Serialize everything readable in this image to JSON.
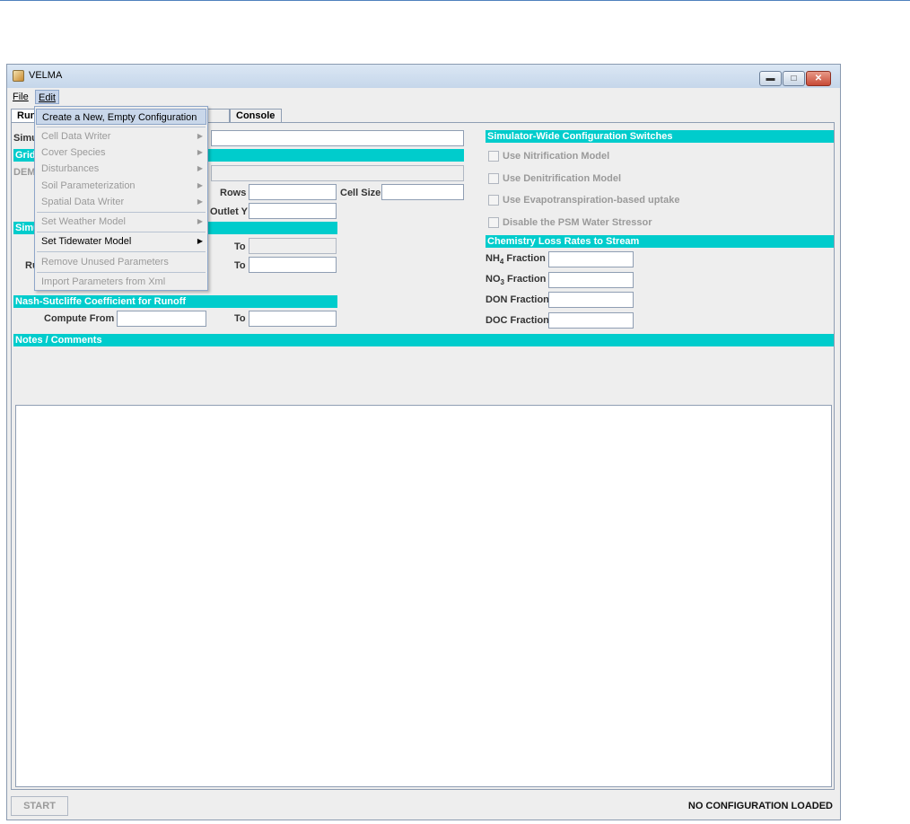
{
  "window": {
    "title": "VELMA"
  },
  "menubar": {
    "file": "File",
    "edit": "Edit"
  },
  "tabs": {
    "run": "Run",
    "chart": "Chart",
    "console": "Console",
    "chart_visible": "art"
  },
  "edit_menu": {
    "items": [
      {
        "label": "Create a New, Empty Configuration",
        "state": "selected"
      },
      {
        "label": "Cell Data Writer",
        "state": "disabled",
        "submenu": true
      },
      {
        "label": "Cover Species",
        "state": "disabled",
        "submenu": true
      },
      {
        "label": "Disturbances",
        "state": "disabled",
        "submenu": true
      },
      {
        "label": "Soil Parameterization",
        "state": "disabled",
        "submenu": true
      },
      {
        "label": "Spatial Data Writer",
        "state": "disabled",
        "submenu": true
      },
      {
        "label": "Set Weather Model",
        "state": "disabled",
        "submenu": true
      },
      {
        "label": "Set Tidewater Model",
        "state": "enabled",
        "submenu": true
      },
      {
        "label": "Remove Unused Parameters",
        "state": "disabled"
      },
      {
        "label": "Import Parameters from Xml",
        "state": "disabled"
      }
    ]
  },
  "left": {
    "sim_label": "Simu",
    "grid_label": "Grid",
    "dem_label": "DEM",
    "rows_label": "Rows",
    "cell_size_label": "Cell Size",
    "outlet_y_label": "Outlet Y",
    "sim2_label": "Simu",
    "to1_label": "To",
    "ru_label": "Ru",
    "to2_label": "To",
    "nash_header": "Nash-Sutcliffe Coefficient for Runoff",
    "compute_from_label": "Compute From",
    "to3_label": "To"
  },
  "right": {
    "switches_header": "Simulator-Wide Configuration Switches",
    "switches": [
      "Use Nitrification Model",
      "Use Denitrification Model",
      "Use Evapotranspiration-based uptake",
      "Disable the PSM Water Stressor"
    ],
    "chem_header": "Chemistry Loss Rates to Stream",
    "nh4": {
      "base": "NH",
      "sub": "4",
      "rest": " Fraction"
    },
    "no3": {
      "base": "NO",
      "sub": "3",
      "rest": " Fraction"
    },
    "don_label": "DON Fraction",
    "doc_label": "DOC Fraction"
  },
  "notes": {
    "header": "Notes / Comments",
    "value": ""
  },
  "bottom": {
    "start": "START",
    "status": "NO CONFIGURATION LOADED"
  }
}
